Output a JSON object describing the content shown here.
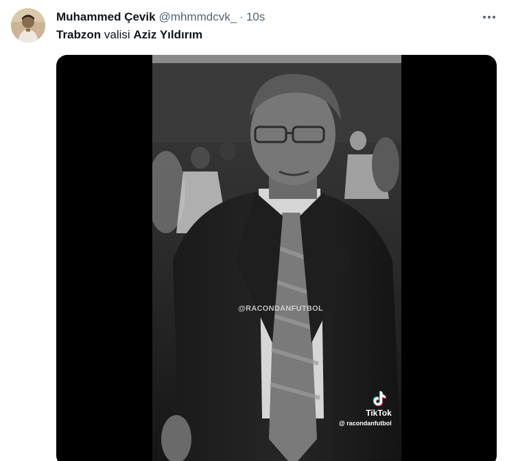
{
  "tweet": {
    "display_name": "Muhammed Çevik",
    "handle": "@mhmmdcvk_",
    "separator": "·",
    "time": "10s",
    "text_parts": {
      "part1": "Trabzon",
      "part2": " valisi ",
      "part3": "Aziz Yıldırım"
    },
    "more_icon": "more-horizontal-icon"
  },
  "media": {
    "center_watermark": "@RACONDANFUTBOL",
    "tiktok_brand": "TikTok",
    "tiktok_user": "@ racondanfutbol"
  }
}
